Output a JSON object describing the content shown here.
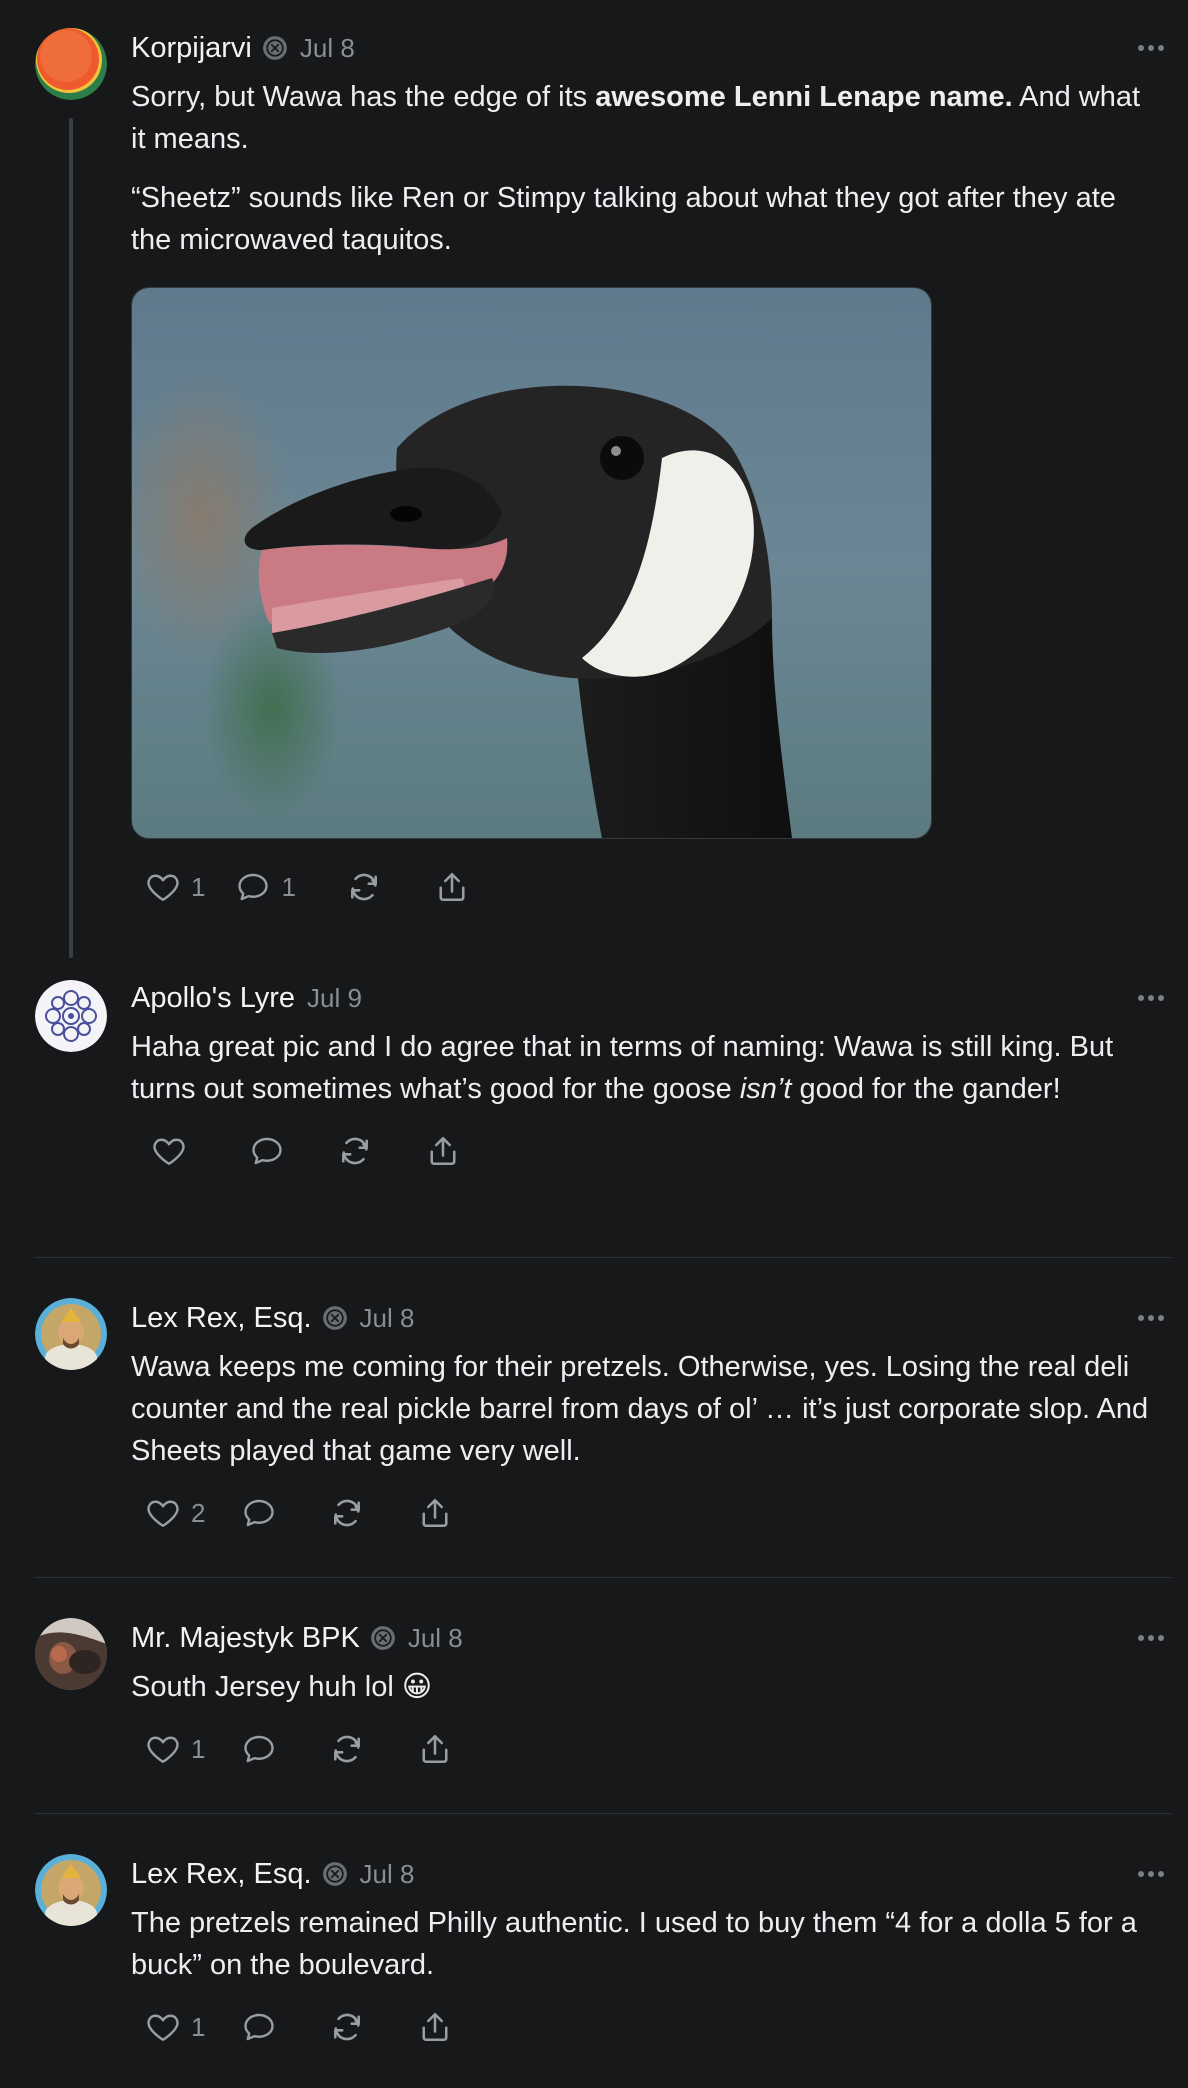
{
  "posts": [
    {
      "author": "Korpijarvi",
      "verified": true,
      "date": "Jul 8",
      "paragraphs": [
        [
          "Sorry, but Wawa has the edge of its ",
          "awesome Lenni Lenape name.",
          " And what it means."
        ],
        [
          "“Sheetz” sounds like Ren or Stimpy talking about what they got after they ate the microwaved taquitos."
        ]
      ],
      "image": "photo-canada-goose",
      "likes": "1",
      "replies": "1"
    },
    {
      "author": "Apollo's Lyre",
      "verified": false,
      "date": "Jul 9",
      "text_before": "Haha great pic and I do agree that in terms of naming: Wawa is still king. But turns out sometimes what’s good for the goose ",
      "text_italic": "isn’t",
      "text_after": " good for the gander!",
      "likes": "",
      "replies": ""
    },
    {
      "author": "Lex Rex, Esq.",
      "verified": true,
      "date": "Jul 8",
      "text": "Wawa keeps me coming for their pretzels. Otherwise, yes. Losing the real deli counter and the real pickle barrel from days of ol’ … it’s just corporate slop. And Sheets played that game very well.",
      "likes": "2",
      "replies": ""
    },
    {
      "author": "Mr. Majestyk BPK",
      "verified": true,
      "date": "Jul 8",
      "text": "South Jersey huh lol 😀",
      "likes": "1",
      "replies": ""
    },
    {
      "author": "Lex Rex, Esq.",
      "verified": true,
      "date": "Jul 8",
      "text": "The pretzels remained Philly authentic. I used to buy them “4 for a dolla 5 for a buck” on the boulevard.",
      "likes": "1",
      "replies": ""
    }
  ],
  "icons": {
    "like": "heart-icon",
    "reply": "comment-icon",
    "repost": "repost-icon",
    "share": "share-icon",
    "more": "more-options-icon",
    "verified": "verified-badge-icon"
  },
  "colors": {
    "background": "#17181a",
    "text": "#eceef0",
    "muted": "#8a8d93",
    "divider": "#2e3135"
  }
}
